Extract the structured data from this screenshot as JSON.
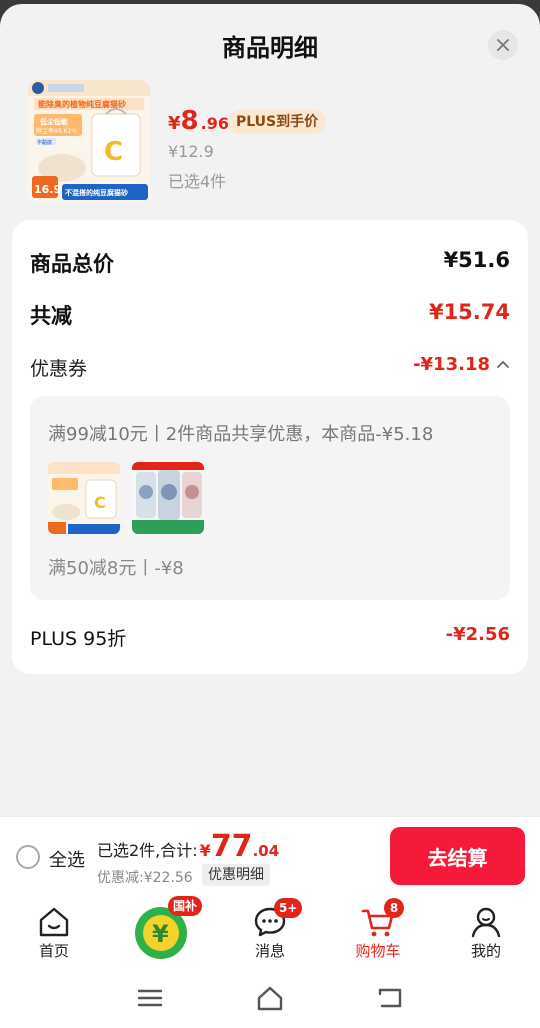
{
  "header": {
    "title": "商品明细"
  },
  "product": {
    "image_label": "植物纯豆腐猫砂",
    "image_lines": [
      "能除臭的植物纯豆腐猫砂",
      "低尘低敏",
      "除尘率99.61%",
      "不黏底",
      "16.9",
      "不混搭的纯豆腐猫砂",
      "C"
    ],
    "price_symbol": "¥",
    "price_int": "8",
    "price_dec": ".96",
    "plus_tag": "PLUS到手价",
    "original_price": "¥12.9",
    "selected": "已选4件"
  },
  "summary": {
    "total_label": "商品总价",
    "total_value": "¥51.6",
    "reduced_label": "共减",
    "reduced_value": "¥15.74",
    "coupon_label": "优惠券",
    "coupon_value": "-¥13.18",
    "coupon_desc1": "满99减10元丨2件商品共享优惠，本商品-¥5.18",
    "coupon_desc2": "满50减8元丨-¥8",
    "plus_label": "PLUS 95折",
    "plus_value": "-¥2.56"
  },
  "checkout": {
    "select_all": "全选",
    "total_prefix": "已选2件,合计:",
    "total_symbol": "¥",
    "total_int": "77",
    "total_dec": ".04",
    "discount": "优惠减:¥22.56",
    "discount_detail": "优惠明细",
    "button": "去结算"
  },
  "tabs": [
    {
      "label": "首页",
      "icon": "home-icon",
      "badge": ""
    },
    {
      "label": "",
      "icon": "subsidy-icon",
      "badge": "国补"
    },
    {
      "label": "消息",
      "icon": "message-icon",
      "badge": "5+"
    },
    {
      "label": "购物车",
      "icon": "cart-icon",
      "badge": "8"
    },
    {
      "label": "我的",
      "icon": "profile-icon",
      "badge": ""
    }
  ],
  "colors": {
    "accent": "#e1251b",
    "checkout": "#f5193a",
    "plus_tag_bg": "#fce7d1"
  }
}
